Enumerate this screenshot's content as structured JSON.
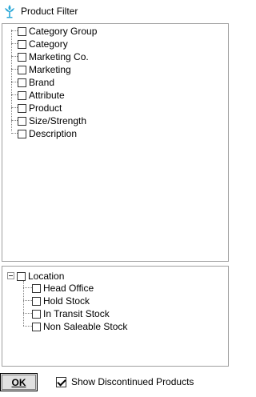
{
  "window": {
    "title": "Product Filter",
    "icon": "app-logo-icon"
  },
  "product_tree": {
    "items": [
      {
        "label": "Category Group",
        "checked": false
      },
      {
        "label": "Category",
        "checked": false
      },
      {
        "label": "Marketing Co.",
        "checked": false
      },
      {
        "label": "Marketing",
        "checked": false
      },
      {
        "label": "Brand",
        "checked": false
      },
      {
        "label": "Attribute",
        "checked": false
      },
      {
        "label": "Product",
        "checked": false
      },
      {
        "label": "Size/Strength",
        "checked": false
      },
      {
        "label": "Description",
        "checked": false
      }
    ]
  },
  "location_tree": {
    "root": {
      "label": "Location",
      "checked": false,
      "expanded": true
    },
    "children": [
      {
        "label": "Head Office",
        "checked": false
      },
      {
        "label": "Hold Stock",
        "checked": false
      },
      {
        "label": "In Transit Stock",
        "checked": false
      },
      {
        "label": "Non Saleable Stock",
        "checked": false
      }
    ]
  },
  "footer": {
    "ok_label": "OK",
    "show_discontinued_label": "Show Discontinued Products",
    "show_discontinued_checked": true
  }
}
